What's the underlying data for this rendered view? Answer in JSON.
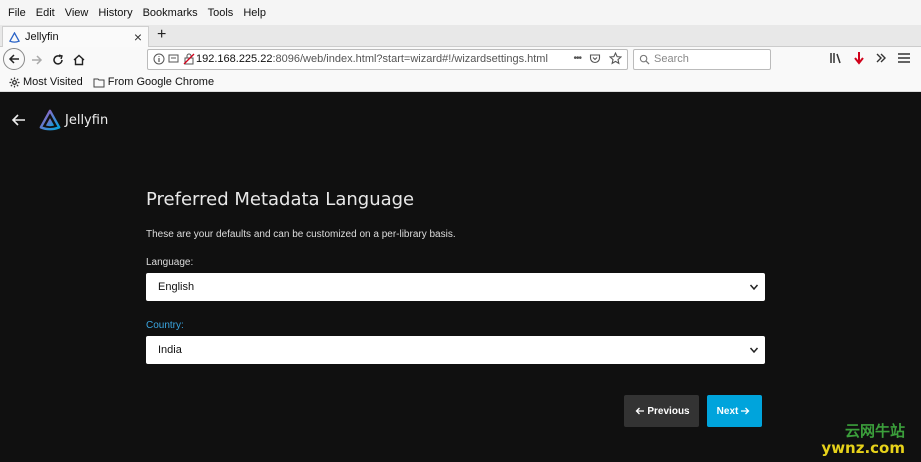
{
  "menubar": {
    "items": [
      {
        "label": "File"
      },
      {
        "label": "Edit"
      },
      {
        "label": "View"
      },
      {
        "label": "History"
      },
      {
        "label": "Bookmarks"
      },
      {
        "label": "Tools"
      },
      {
        "label": "Help"
      }
    ]
  },
  "tab": {
    "title": "Jellyfin",
    "close": "×"
  },
  "new_tab_label": "+",
  "urlbar": {
    "host": "192.168.225.22",
    "rest": ":8096/web/index.html?start=wizard#!/wizardsettings.html",
    "more": "•••"
  },
  "searchbar": {
    "placeholder": "Search"
  },
  "bookmarks": [
    {
      "label": "Most Visited",
      "icon": "gear-icon"
    },
    {
      "label": "From Google Chrome",
      "icon": "folder-icon"
    }
  ],
  "app": {
    "brand": "Jellyfin",
    "heading": "Preferred Metadata Language",
    "description": "These are your defaults and can be customized on a per-library basis.",
    "language_label": "Language:",
    "language_value": "English",
    "country_label": "Country:",
    "country_value": "India",
    "previous_label": "Previous",
    "next_label": "Next"
  },
  "watermark": {
    "cn": "云网牛站",
    "en": "ywnz.com"
  },
  "colors": {
    "accent": "#00a4dc",
    "page_bg": "#101010",
    "country_label": "#3aa5e0",
    "prev_bg": "#333333"
  }
}
